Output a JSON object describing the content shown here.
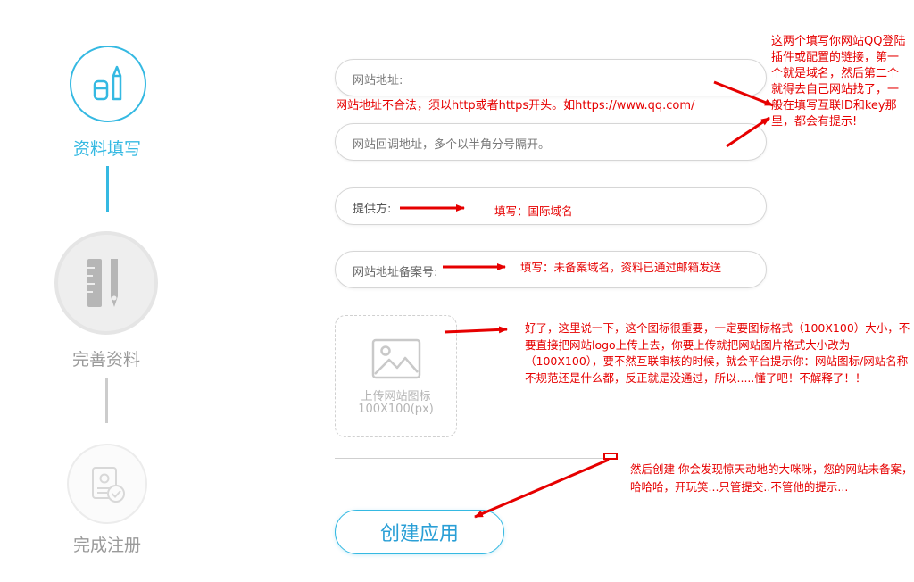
{
  "steps": [
    {
      "label": "资料填写",
      "state": "active",
      "icon": "pencil-document-icon"
    },
    {
      "label": "完善资料",
      "state": "inactive",
      "icon": "ruler-pen-icon"
    },
    {
      "label": "完成注册",
      "state": "inactive",
      "icon": "badge-check-icon"
    }
  ],
  "form": {
    "website_address": {
      "placeholder": "网站地址:"
    },
    "url_error": "网站地址不合法，须以http或者https开头。如https://www.qq.com/",
    "callback_address": {
      "placeholder": "网站回调地址，多个以半角分号隔开。"
    },
    "provider": {
      "label": "提供方:"
    },
    "icp_number": {
      "label": "网站地址备案号:"
    },
    "upload": {
      "line1": "上传网站图标",
      "line2": "100X100(px)",
      "icon": "image-icon"
    },
    "submit_label": "创建应用"
  },
  "annotations": {
    "provider_note": "填写：国际域名",
    "icp_note": "填写：未备案域名，资料已通过邮箱发送",
    "right_note": "这两个填写你网站QQ登陆插件或配置的链接，第一个就是域名，然后第二个就得去自己网站找了，一般在填写互联ID和key那里，都会有提示!",
    "icon_note": "好了，这里说一下，这个图标很重要，一定要图标格式（100X100）大小，不要直接把网站logo上传上去，你要上传就把网站图片格式大小改为（100X100），要不然互联审核的时候，就会平台提示你：网站图标/网站名称不规范还是什么都，反正就是没通过，所以.....懂了吧！不解释了！！",
    "bottom_note": "然后创建 你会发现惊天动地的大咪咪，您的网站未备案，哈哈哈，开玩笑...只管提交..不管他的提示..."
  },
  "colors": {
    "accent": "#35b9e2",
    "annotation": "#e60000",
    "inactive": "#a9a9a9"
  }
}
